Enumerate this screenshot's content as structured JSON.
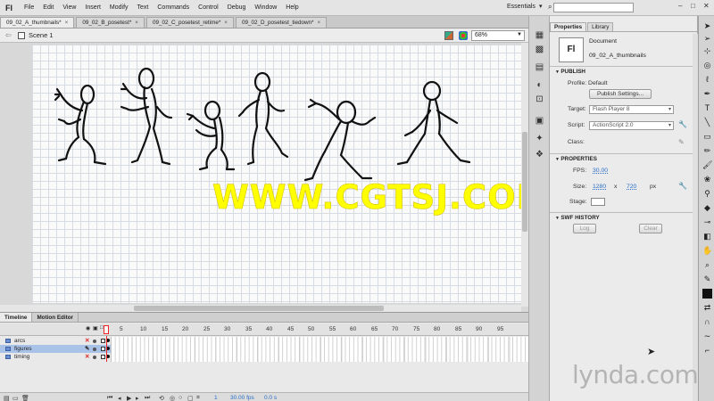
{
  "app": {
    "logo": "Fl",
    "menu": [
      "File",
      "Edit",
      "View",
      "Insert",
      "Modify",
      "Text",
      "Commands",
      "Control",
      "Debug",
      "Window",
      "Help"
    ],
    "workspace": "Essentials",
    "window_buttons": [
      "–",
      "□",
      "✕"
    ]
  },
  "doc_tabs": [
    {
      "label": "09_02_A_thumbnails*",
      "active": true
    },
    {
      "label": "09_02_B_posetest*",
      "active": false
    },
    {
      "label": "09_02_C_posetest_retime*",
      "active": false
    },
    {
      "label": "09_02_D_posetest_tiedown*",
      "active": false
    }
  ],
  "scene": {
    "label": "Scene 1",
    "zoom": "68%"
  },
  "watermark": "WWW.CGTSJ.COM",
  "timeline": {
    "tabs": [
      "Timeline",
      "Motion Editor"
    ],
    "frame_numbers": [
      "5",
      "10",
      "15",
      "20",
      "25",
      "30",
      "35",
      "40",
      "45",
      "50",
      "55",
      "60",
      "65",
      "70",
      "75",
      "80",
      "85",
      "90",
      "95"
    ],
    "layers": [
      {
        "name": "arcs",
        "selected": false
      },
      {
        "name": "figures",
        "selected": true
      },
      {
        "name": "timing",
        "selected": false
      }
    ],
    "current_frame": "1",
    "fps": "30.00 fps",
    "time": "0.0 s"
  },
  "properties": {
    "tabs": [
      "Properties",
      "Library"
    ],
    "doc_kind": "Document",
    "doc_name": "09_02_A_thumbnails",
    "publish": {
      "header": "PUBLISH",
      "profile_label": "Profile: Default",
      "publish_settings_btn": "Publish Settings...",
      "target_label": "Target:",
      "target_value": "Flash Player 8",
      "script_label": "Script:",
      "script_value": "ActionScript 2.0",
      "class_label": "Class:"
    },
    "props": {
      "header": "PROPERTIES",
      "fps_label": "FPS:",
      "fps_value": "30.00",
      "size_label": "Size:",
      "width": "1280",
      "x": "x",
      "height": "720",
      "unit": "px",
      "stage_label": "Stage:"
    },
    "swf_history": {
      "header": "SWF HISTORY",
      "log_btn": "Log",
      "clear_btn": "Clear"
    }
  },
  "brand": "lynda.com",
  "colors": {
    "watermark": "#ffff00",
    "accent_blue": "#2a6ec8",
    "playhead": "#ee2222"
  }
}
